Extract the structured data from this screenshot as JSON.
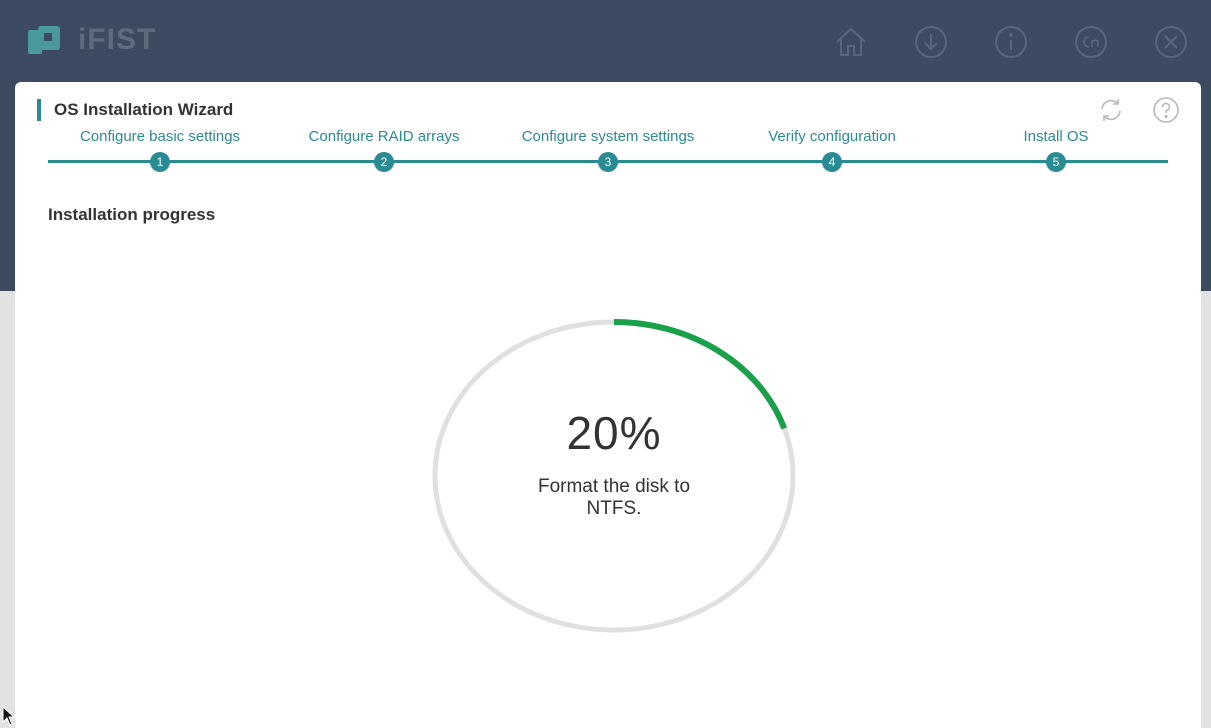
{
  "app": {
    "logo_text": "iFIST"
  },
  "header": {
    "icons": [
      "home-icon",
      "download-icon",
      "info-icon",
      "language-icon",
      "close-icon"
    ]
  },
  "wizard": {
    "title": "OS Installation Wizard",
    "icons": [
      "refresh-icon",
      "help-icon"
    ],
    "steps": [
      {
        "number": "1",
        "label": "Configure basic settings"
      },
      {
        "number": "2",
        "label": "Configure RAID arrays"
      },
      {
        "number": "3",
        "label": "Configure system settings"
      },
      {
        "number": "4",
        "label": "Verify configuration"
      },
      {
        "number": "5",
        "label": "Install OS"
      }
    ]
  },
  "progress": {
    "section_title": "Installation progress",
    "percent_text": "20%",
    "fraction": 0.2,
    "status": "Format the disk to NTFS."
  },
  "colors": {
    "header_bg": "#3d4b60",
    "accent": "#2a8c93",
    "progress_fill": "#1aa04a",
    "progress_track": "#e0e0e0"
  }
}
